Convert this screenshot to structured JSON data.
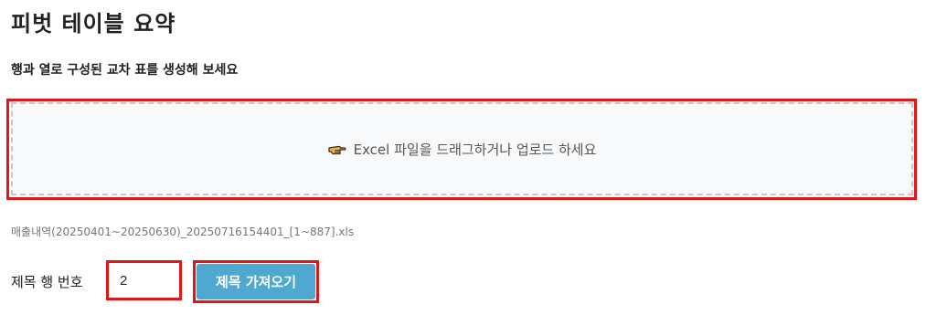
{
  "header": {
    "title": "피벗 테이블 요약",
    "subtitle": "행과 열로 구성된 교차 표를 생성해 보세요"
  },
  "dropzone": {
    "icon": "pointing-hand-icon",
    "label": "Excel 파일을 드래그하거나 업로드 하세요"
  },
  "file": {
    "name": "매출내역(20250401~20250630)_20250716154401_[1~887].xls"
  },
  "header_row": {
    "label": "제목 행 번호",
    "value": "2",
    "button_label": "제목 가져오기"
  },
  "colors": {
    "highlight": "#e0161b",
    "button": "#4ea8cf",
    "dropzone_bg": "#f8f9fa"
  }
}
